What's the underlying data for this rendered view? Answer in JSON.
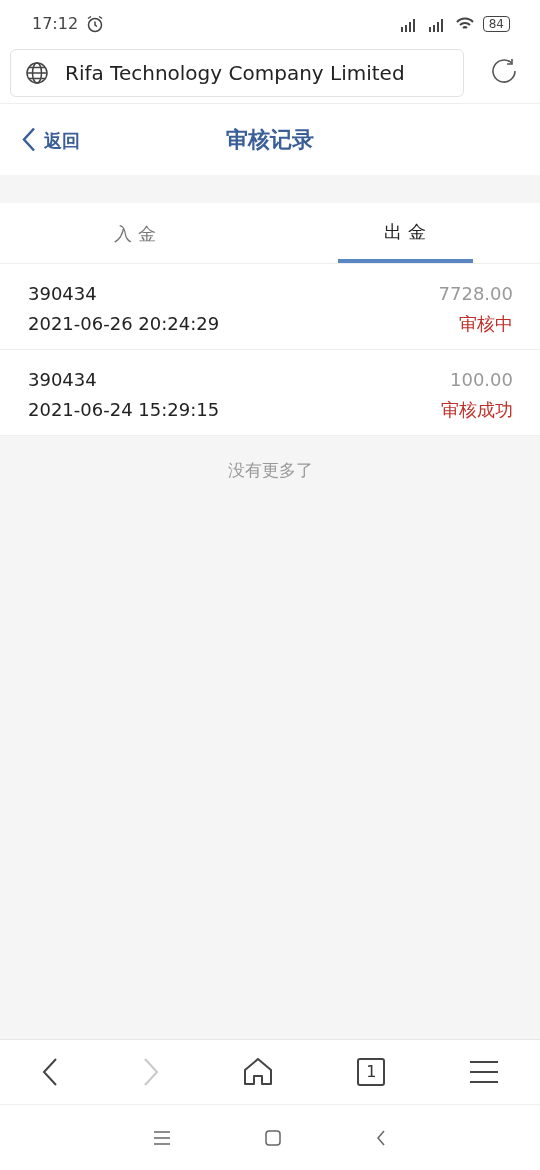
{
  "status_bar": {
    "time": "17:12",
    "battery": "84"
  },
  "browser": {
    "url_title": "Rifa Technology Company Limited",
    "tab_count": "1",
    "forward_disabled": true
  },
  "header": {
    "back": "返回",
    "title": "审核记录"
  },
  "tabs": [
    {
      "label": "入 金",
      "selected": false
    },
    {
      "label": "出 金",
      "selected": true
    }
  ],
  "records": [
    {
      "account": "390434",
      "amount": "7728.00",
      "time": "2021-06-26 20:24:29",
      "status": "审核中"
    },
    {
      "account": "390434",
      "amount": "100.00",
      "time": "2021-06-24 15:29:15",
      "status": "审核成功"
    }
  ],
  "end_note": "没有更多了"
}
